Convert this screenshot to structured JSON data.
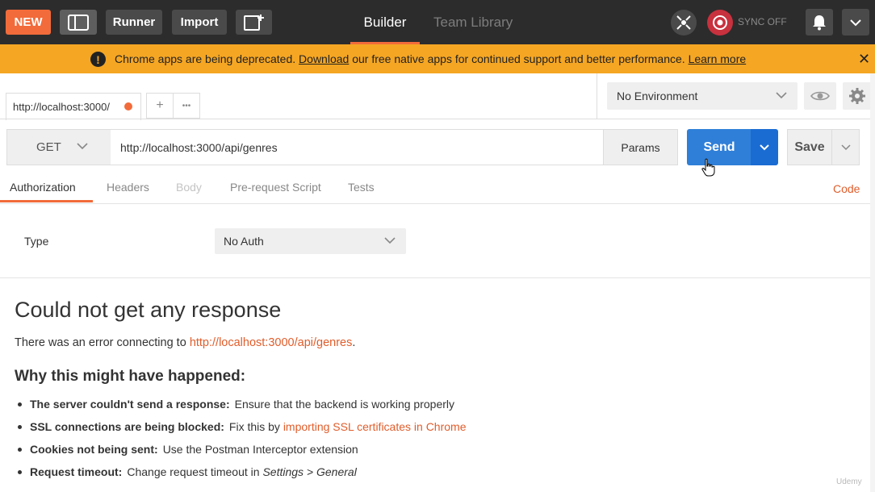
{
  "topbar": {
    "new_label": "NEW",
    "runner_label": "Runner",
    "import_label": "Import",
    "tabs": [
      {
        "label": "Builder",
        "active": true
      },
      {
        "label": "Team Library",
        "active": false
      }
    ],
    "sync_label": "SYNC OFF",
    "icons": [
      "sidebar-toggle-icon",
      "new-window-icon",
      "interceptor-icon",
      "sync-icon",
      "bell-icon",
      "chevron-down-icon"
    ]
  },
  "banner": {
    "text_before": "Chrome apps are being deprecated.",
    "download_link": "Download",
    "text_middle": "our free native apps for continued support and better performance.",
    "learn_more_link": "Learn more",
    "close": "✕"
  },
  "request_tab": {
    "label": "http://localhost:3000/",
    "add_label": "+",
    "more_label": "•••"
  },
  "environment": {
    "selected": "No Environment"
  },
  "request": {
    "method": "GET",
    "url": "http://localhost:3000/api/genres",
    "params_label": "Params",
    "send_label": "Send",
    "save_label": "Save"
  },
  "subtabs": [
    {
      "label": "Authorization",
      "state": "active"
    },
    {
      "label": "Headers",
      "state": "normal"
    },
    {
      "label": "Body",
      "state": "disabled"
    },
    {
      "label": "Pre-request Script",
      "state": "normal"
    },
    {
      "label": "Tests",
      "state": "normal"
    }
  ],
  "code_link": "Code",
  "auth": {
    "type_label": "Type",
    "type_value": "No Auth"
  },
  "response": {
    "title": "Could not get any response",
    "message_before": "There was an error connecting to",
    "message_link": "http://localhost:3000/api/genres",
    "message_after": ".",
    "why_title": "Why this might have happened:",
    "reasons": [
      {
        "bold": "The server couldn't send a response:",
        "text": "Ensure that the backend is working properly",
        "link": ""
      },
      {
        "bold": "SSL connections are being blocked:",
        "text": "Fix this by",
        "link": "importing SSL certificates in Chrome"
      },
      {
        "bold": "Cookies not being sent:",
        "text": "Use the Postman Interceptor extension",
        "link": ""
      },
      {
        "bold": "Request timeout:",
        "text": "Change request timeout in",
        "link": "",
        "italic": "Settings > General"
      }
    ]
  },
  "watermark": "Udemy",
  "colors": {
    "accent": "#f26b3a",
    "send_blue": "#2f7fd8",
    "banner": "#f5a623",
    "link": "#e05d2b"
  }
}
